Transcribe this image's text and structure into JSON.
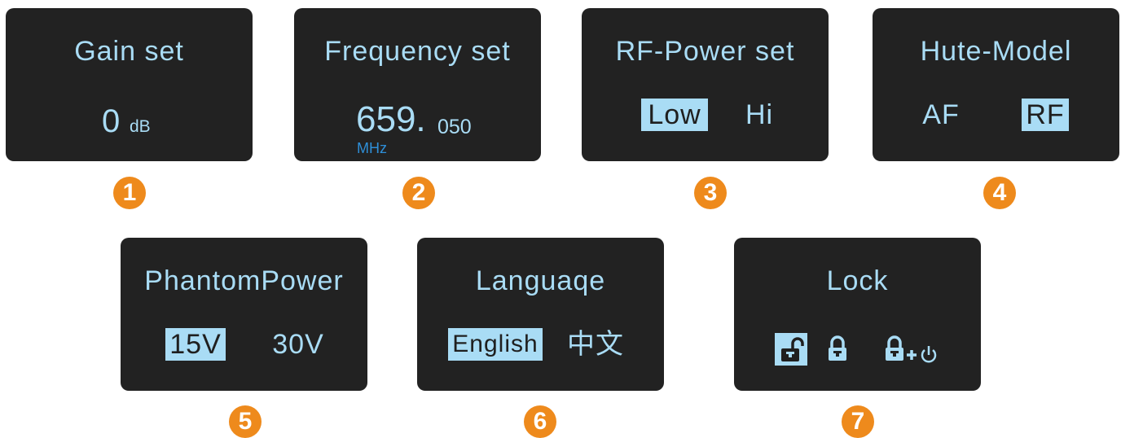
{
  "screens": [
    {
      "title": "Gain set",
      "value": "0",
      "unit": "dB"
    },
    {
      "title": "Frequency set",
      "value_major": "659.",
      "value_minor": "050",
      "unit": "MHz"
    },
    {
      "title": "RF-Power set",
      "options": [
        "Low",
        "Hi"
      ],
      "selected": "Low"
    },
    {
      "title": "Hute-Model",
      "options": [
        "AF",
        "RF"
      ],
      "selected": "RF"
    },
    {
      "title": "PhantomPower",
      "options": [
        "15V",
        "30V"
      ],
      "selected": "15V"
    },
    {
      "title": "Languaqe",
      "options": [
        "English",
        "中文"
      ],
      "selected": "English"
    },
    {
      "title": "Lock",
      "options": [
        "unlock-icon",
        "lock-icon",
        "lock-power-icon"
      ],
      "selected": "unlock-icon"
    }
  ],
  "badges": [
    "1",
    "2",
    "3",
    "4",
    "5",
    "6",
    "7"
  ],
  "colors": {
    "screen_bg": "#222222",
    "text": "#a9dcf5",
    "highlight_bg": "#a9dcf5",
    "unit_blue": "#2e8fd8",
    "badge": "#ee8a1c"
  }
}
